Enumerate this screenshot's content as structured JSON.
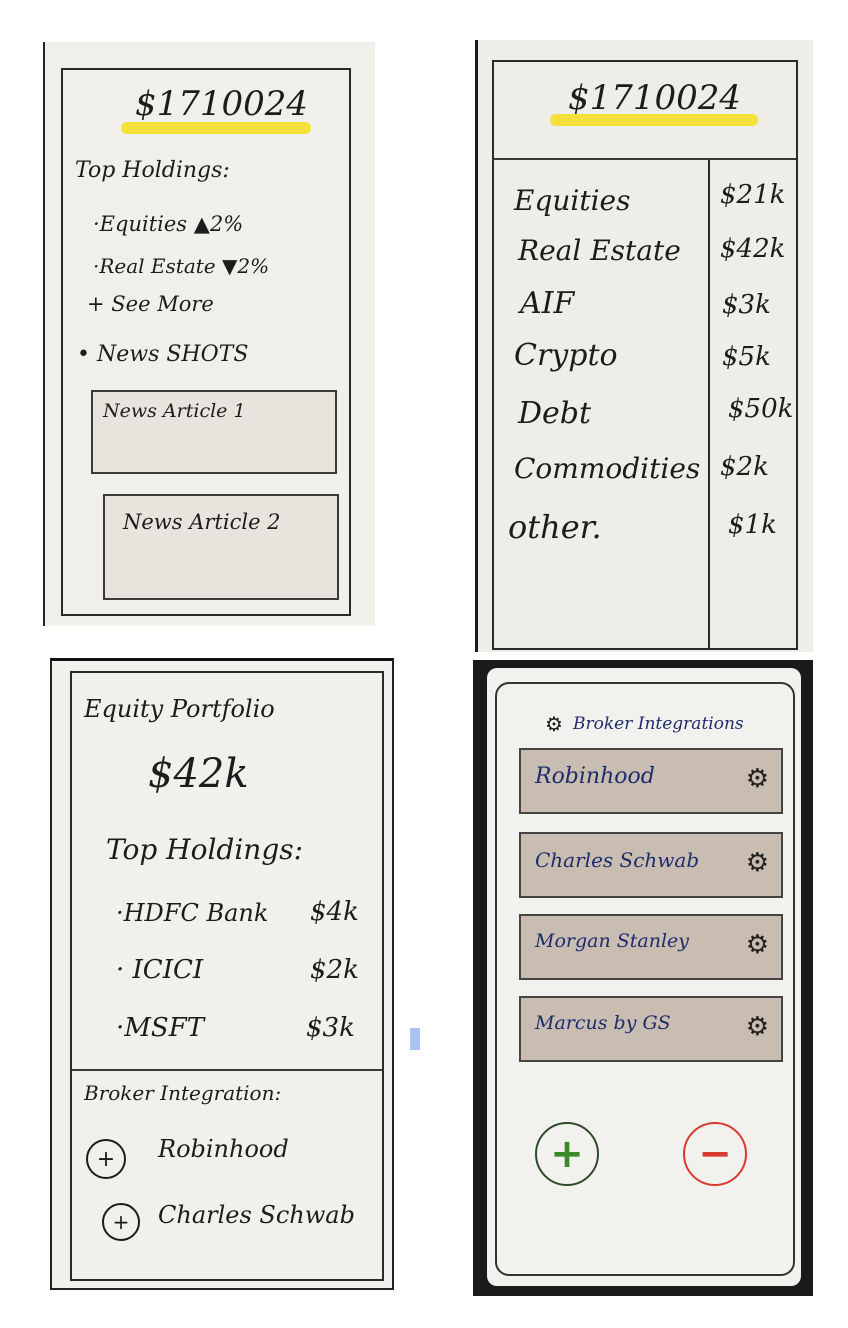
{
  "overview": {
    "total": "$1710024",
    "top_holdings_label": "Top Holdings:",
    "holdings": [
      "·Equities ▲2%",
      "·Real Estate ▼2%"
    ],
    "see_more": "+ See More",
    "news_shots_label": "• News SHOTS",
    "articles": [
      "News Article 1",
      "News Article 2"
    ]
  },
  "allocation": {
    "total": "$1710024",
    "rows": [
      {
        "name": "Equities",
        "value": "$21k"
      },
      {
        "name": "Real Estate",
        "value": "$42k"
      },
      {
        "name": "AIF",
        "value": "$3k"
      },
      {
        "name": "Crypto",
        "value": "$5k"
      },
      {
        "name": "Debt",
        "value": "$50k"
      },
      {
        "name": "Commodities",
        "value": "$2k"
      },
      {
        "name": "other.",
        "value": "$1k"
      }
    ]
  },
  "equity": {
    "title": "Equity Portfolio",
    "total": "$42k",
    "top_holdings_label": "Top Holdings:",
    "holdings": [
      {
        "name": "·HDFC Bank",
        "value": "$4k"
      },
      {
        "name": "· ICICI",
        "value": "$2k"
      },
      {
        "name": "·MSFT",
        "value": "$3k"
      }
    ],
    "broker_label": "Broker Integration:",
    "brokers": [
      "Robinhood",
      "Charles Schwab"
    ]
  },
  "integrations": {
    "title": "Broker Integrations",
    "brokers": [
      "Robinhood",
      "Charles Schwab",
      "Morgan Stanley",
      "Marcus by GS"
    ],
    "add_symbol": "+",
    "remove_symbol": "−",
    "add_color": "#3a8a2a",
    "remove_color": "#d83a2e"
  },
  "colors": {
    "highlight": "#f4e23a",
    "ink": "#1c1c1c",
    "broker_box": "#c8bdb0"
  }
}
